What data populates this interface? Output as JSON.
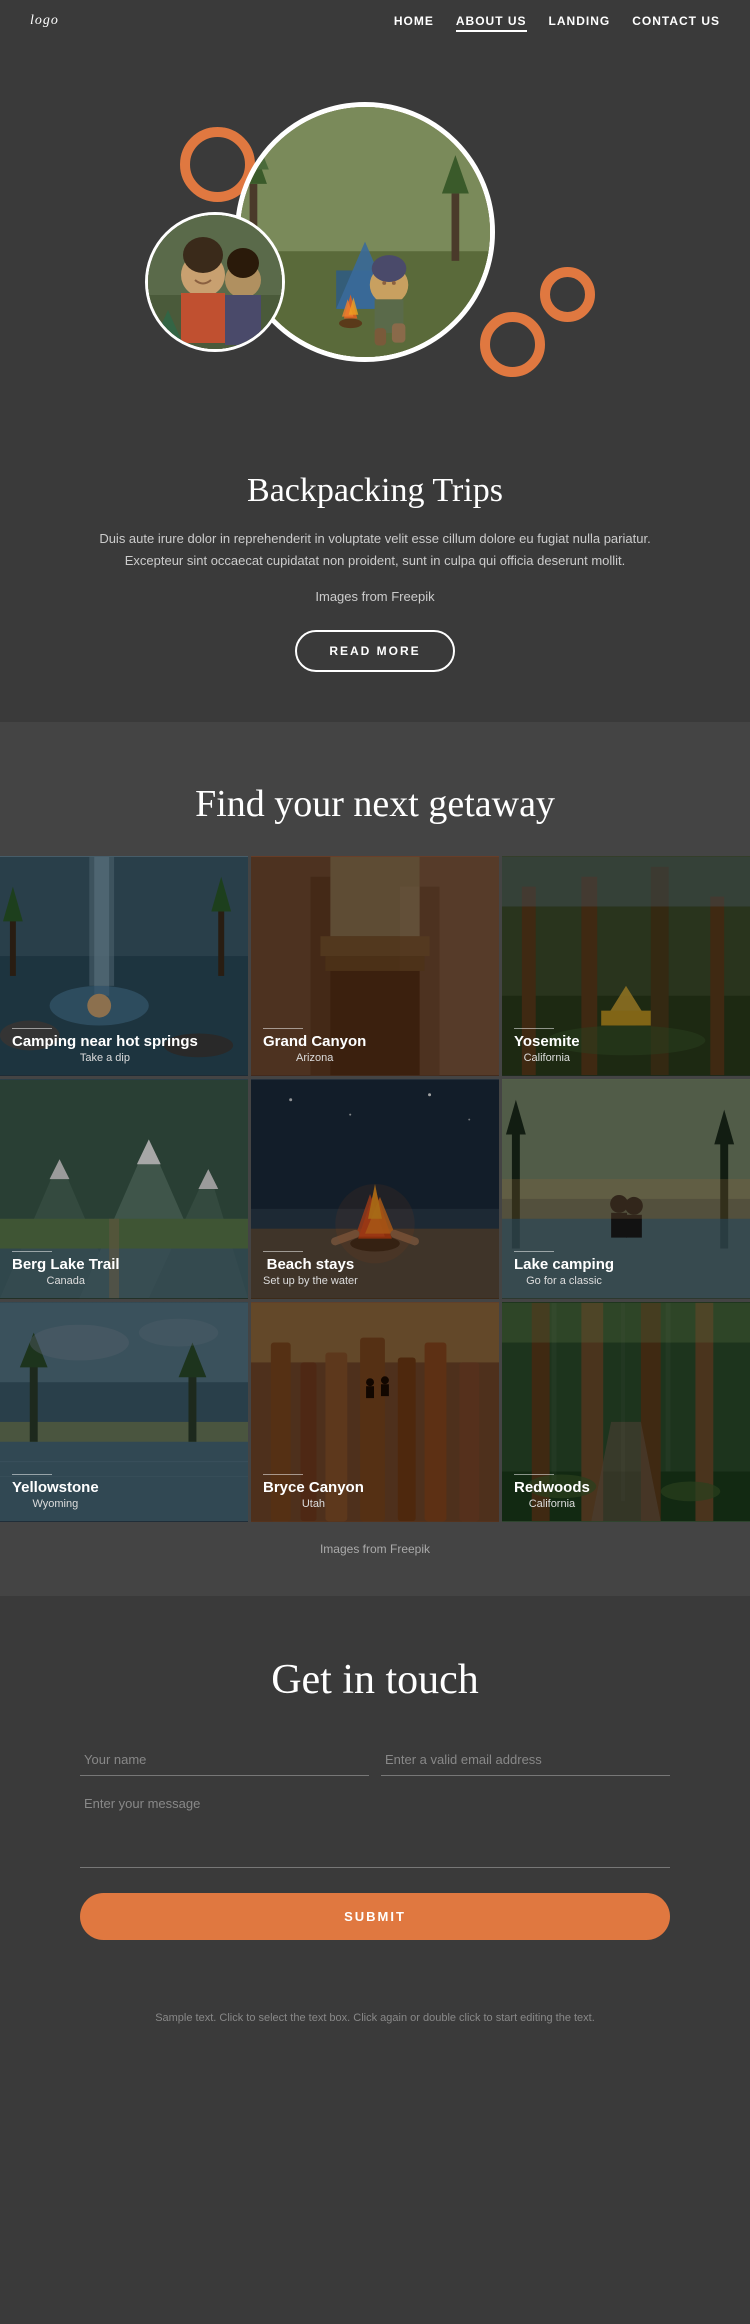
{
  "nav": {
    "logo": "logo",
    "links": [
      {
        "label": "HOME",
        "href": "#",
        "active": false
      },
      {
        "label": "ABOUT US",
        "href": "#",
        "active": true
      },
      {
        "label": "LANDING",
        "href": "#",
        "active": false
      },
      {
        "label": "CONTACT US",
        "href": "#",
        "active": false
      }
    ]
  },
  "hero": {
    "ring_color": "#e07840"
  },
  "backpacking": {
    "title": "Backpacking Trips",
    "description": "Duis aute irure dolor in reprehenderit in voluptate velit esse cillum dolore eu fugiat nulla pariatur. Excepteur sint occaecat cupidatat non proident, sunt in culpa qui officia deserunt mollit.",
    "images_credit": "Images from Freepik",
    "read_more": "READ MORE"
  },
  "getaway": {
    "title": "Find your next getaway",
    "images_credit": "Images from Freepik",
    "grid_items": [
      {
        "title": "Camping near hot springs",
        "subtitle": "Take a dip",
        "bg": "bg-waterfall"
      },
      {
        "title": "Grand Canyon",
        "subtitle": "Arizona",
        "bg": "bg-canyon"
      },
      {
        "title": "Yosemite",
        "subtitle": "California",
        "bg": "bg-yosemite"
      },
      {
        "title": "Berg Lake Trail",
        "subtitle": "Canada",
        "bg": "bg-berglake"
      },
      {
        "title": "Beach stays",
        "subtitle": "Set up by the water",
        "bg": "bg-beach"
      },
      {
        "title": "Lake camping",
        "subtitle": "Go for a classic",
        "bg": "bg-lakecamping"
      },
      {
        "title": "Yellowstone",
        "subtitle": "Wyoming",
        "bg": "bg-yellowstone"
      },
      {
        "title": "Bryce Canyon",
        "subtitle": "Utah",
        "bg": "bg-bryce"
      },
      {
        "title": "Redwoods",
        "subtitle": "California",
        "bg": "bg-redwoods"
      }
    ]
  },
  "contact": {
    "title": "Get in touch",
    "name_placeholder": "Your name",
    "email_placeholder": "Enter a valid email address",
    "message_placeholder": "Enter your message",
    "submit_label": "SUBMIT"
  },
  "footer": {
    "note": "Sample text. Click to select the text box. Click again or double click to start editing the text."
  }
}
